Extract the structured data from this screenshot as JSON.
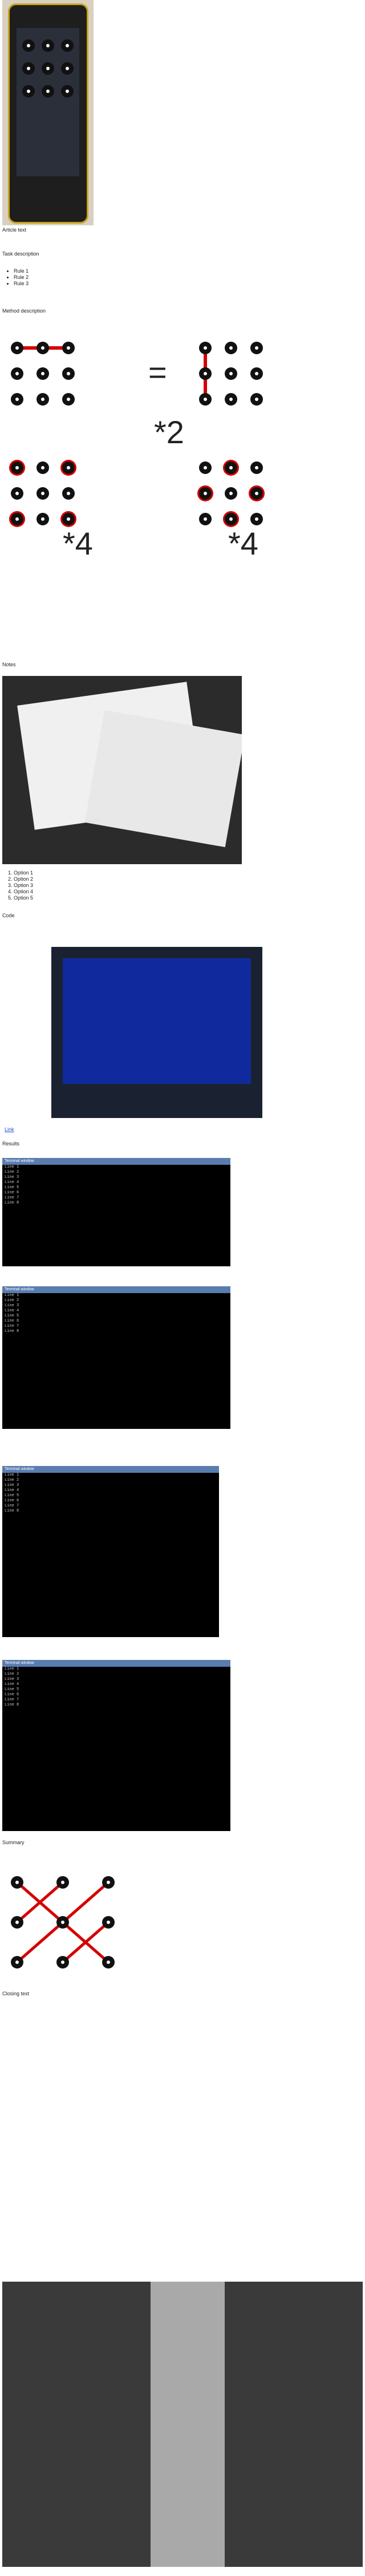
{
  "intro": {
    "text": "Article text"
  },
  "sections": {
    "task": "Task description",
    "rules": [
      "Rule 1",
      "Rule 2",
      "Rule 3"
    ],
    "method": "Method description"
  },
  "pattern_math": {
    "multiplier_1": "*2",
    "multiplier_2": "*4",
    "multiplier_3": "*4"
  },
  "notes_caption": "Notes",
  "options_list": [
    "Option 1",
    "Option 2",
    "Option 3",
    "Option 4",
    "Option 5"
  ],
  "code_caption": "Code",
  "link_text": "Link",
  "result_caption": "Results",
  "terminal_1": {
    "title": "Terminal window",
    "lines": [
      "Line 1",
      "Line 2",
      "Line 3",
      "Line 4",
      "Line 5",
      "Line 6",
      "Line 7",
      "Line 8"
    ]
  },
  "terminal_2": {
    "title": "Terminal window",
    "lines": [
      "Line 1",
      "Line 2",
      "Line 3",
      "Line 4",
      "Line 5",
      "Line 6",
      "Line 7",
      "Line 8"
    ]
  },
  "terminal_3": {
    "title": "Terminal window",
    "lines": [
      "Line 1",
      "Line 2",
      "Line 3",
      "Line 4",
      "Line 5",
      "Line 6",
      "Line 7",
      "Line 8"
    ]
  },
  "terminal_4": {
    "title": "Terminal window",
    "lines": [
      "Line 1",
      "Line 2",
      "Line 3",
      "Line 4",
      "Line 5",
      "Line 6",
      "Line 7",
      "Line 8"
    ]
  },
  "final_caption": "Summary",
  "outro": "Closing text",
  "colors": {
    "accent_red": "#d40000",
    "link": "#1a4fd6"
  }
}
